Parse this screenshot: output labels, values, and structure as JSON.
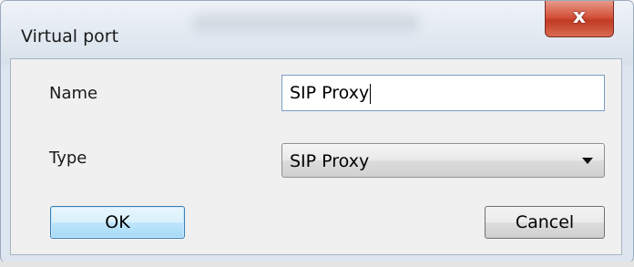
{
  "window": {
    "title": "Virtual port",
    "close_glyph": "x"
  },
  "form": {
    "name_label": "Name",
    "name_value": "SIP Proxy",
    "type_label": "Type",
    "type_value": "SIP Proxy"
  },
  "buttons": {
    "ok_label": "OK",
    "cancel_label": "Cancel"
  },
  "colors": {
    "close_button": "#c13a22",
    "ok_button_border": "#3c7fb1",
    "window_border": "#9aa9bc"
  },
  "icons": {
    "close": "close-icon",
    "dropdown": "chevron-down-icon"
  }
}
